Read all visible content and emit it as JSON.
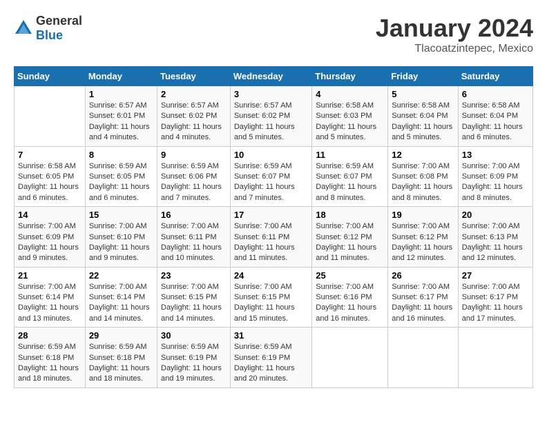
{
  "header": {
    "logo": {
      "general": "General",
      "blue": "Blue"
    },
    "title": "January 2024",
    "subtitle": "Tlacoatzintepec, Mexico"
  },
  "weekdays": [
    "Sunday",
    "Monday",
    "Tuesday",
    "Wednesday",
    "Thursday",
    "Friday",
    "Saturday"
  ],
  "weeks": [
    [
      null,
      {
        "day": 1,
        "sunrise": "6:57 AM",
        "sunset": "6:01 PM",
        "daylight": "11 hours and 4 minutes."
      },
      {
        "day": 2,
        "sunrise": "6:57 AM",
        "sunset": "6:02 PM",
        "daylight": "11 hours and 4 minutes."
      },
      {
        "day": 3,
        "sunrise": "6:57 AM",
        "sunset": "6:02 PM",
        "daylight": "11 hours and 5 minutes."
      },
      {
        "day": 4,
        "sunrise": "6:58 AM",
        "sunset": "6:03 PM",
        "daylight": "11 hours and 5 minutes."
      },
      {
        "day": 5,
        "sunrise": "6:58 AM",
        "sunset": "6:04 PM",
        "daylight": "11 hours and 5 minutes."
      },
      {
        "day": 6,
        "sunrise": "6:58 AM",
        "sunset": "6:04 PM",
        "daylight": "11 hours and 6 minutes."
      }
    ],
    [
      {
        "day": 7,
        "sunrise": "6:58 AM",
        "sunset": "6:05 PM",
        "daylight": "11 hours and 6 minutes."
      },
      {
        "day": 8,
        "sunrise": "6:59 AM",
        "sunset": "6:05 PM",
        "daylight": "11 hours and 6 minutes."
      },
      {
        "day": 9,
        "sunrise": "6:59 AM",
        "sunset": "6:06 PM",
        "daylight": "11 hours and 7 minutes."
      },
      {
        "day": 10,
        "sunrise": "6:59 AM",
        "sunset": "6:07 PM",
        "daylight": "11 hours and 7 minutes."
      },
      {
        "day": 11,
        "sunrise": "6:59 AM",
        "sunset": "6:07 PM",
        "daylight": "11 hours and 8 minutes."
      },
      {
        "day": 12,
        "sunrise": "7:00 AM",
        "sunset": "6:08 PM",
        "daylight": "11 hours and 8 minutes."
      },
      {
        "day": 13,
        "sunrise": "7:00 AM",
        "sunset": "6:09 PM",
        "daylight": "11 hours and 8 minutes."
      }
    ],
    [
      {
        "day": 14,
        "sunrise": "7:00 AM",
        "sunset": "6:09 PM",
        "daylight": "11 hours and 9 minutes."
      },
      {
        "day": 15,
        "sunrise": "7:00 AM",
        "sunset": "6:10 PM",
        "daylight": "11 hours and 9 minutes."
      },
      {
        "day": 16,
        "sunrise": "7:00 AM",
        "sunset": "6:11 PM",
        "daylight": "11 hours and 10 minutes."
      },
      {
        "day": 17,
        "sunrise": "7:00 AM",
        "sunset": "6:11 PM",
        "daylight": "11 hours and 11 minutes."
      },
      {
        "day": 18,
        "sunrise": "7:00 AM",
        "sunset": "6:12 PM",
        "daylight": "11 hours and 11 minutes."
      },
      {
        "day": 19,
        "sunrise": "7:00 AM",
        "sunset": "6:12 PM",
        "daylight": "11 hours and 12 minutes."
      },
      {
        "day": 20,
        "sunrise": "7:00 AM",
        "sunset": "6:13 PM",
        "daylight": "11 hours and 12 minutes."
      }
    ],
    [
      {
        "day": 21,
        "sunrise": "7:00 AM",
        "sunset": "6:14 PM",
        "daylight": "11 hours and 13 minutes."
      },
      {
        "day": 22,
        "sunrise": "7:00 AM",
        "sunset": "6:14 PM",
        "daylight": "11 hours and 14 minutes."
      },
      {
        "day": 23,
        "sunrise": "7:00 AM",
        "sunset": "6:15 PM",
        "daylight": "11 hours and 14 minutes."
      },
      {
        "day": 24,
        "sunrise": "7:00 AM",
        "sunset": "6:15 PM",
        "daylight": "11 hours and 15 minutes."
      },
      {
        "day": 25,
        "sunrise": "7:00 AM",
        "sunset": "6:16 PM",
        "daylight": "11 hours and 16 minutes."
      },
      {
        "day": 26,
        "sunrise": "7:00 AM",
        "sunset": "6:17 PM",
        "daylight": "11 hours and 16 minutes."
      },
      {
        "day": 27,
        "sunrise": "7:00 AM",
        "sunset": "6:17 PM",
        "daylight": "11 hours and 17 minutes."
      }
    ],
    [
      {
        "day": 28,
        "sunrise": "6:59 AM",
        "sunset": "6:18 PM",
        "daylight": "11 hours and 18 minutes."
      },
      {
        "day": 29,
        "sunrise": "6:59 AM",
        "sunset": "6:18 PM",
        "daylight": "11 hours and 18 minutes."
      },
      {
        "day": 30,
        "sunrise": "6:59 AM",
        "sunset": "6:19 PM",
        "daylight": "11 hours and 19 minutes."
      },
      {
        "day": 31,
        "sunrise": "6:59 AM",
        "sunset": "6:19 PM",
        "daylight": "11 hours and 20 minutes."
      },
      null,
      null,
      null
    ]
  ],
  "labels": {
    "sunrise_prefix": "Sunrise: ",
    "sunset_prefix": "Sunset: ",
    "daylight_prefix": "Daylight: "
  }
}
